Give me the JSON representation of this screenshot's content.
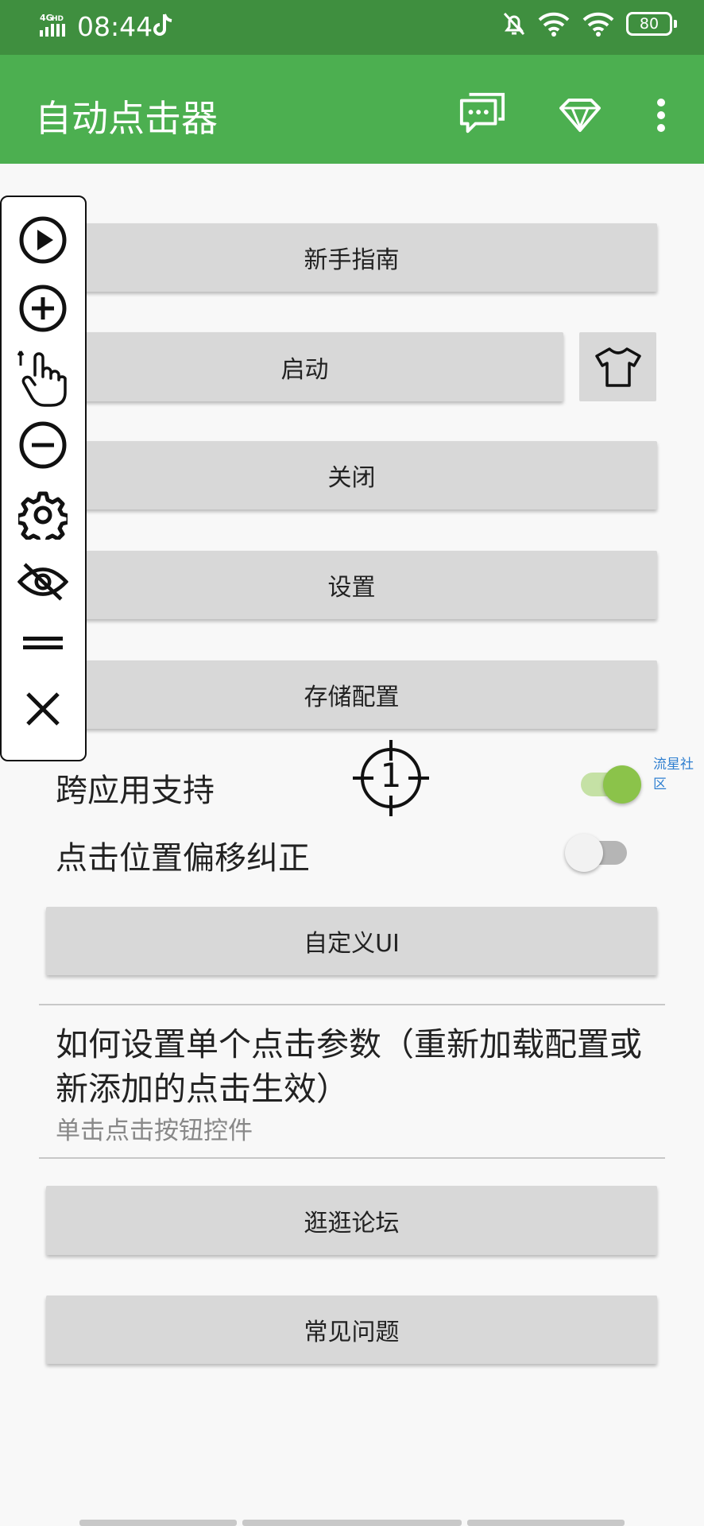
{
  "status_bar": {
    "time": "08:44",
    "network": "4GHD",
    "battery": "80"
  },
  "app_bar": {
    "title": "自动点击器",
    "icons": [
      "chat-icon",
      "diamond-icon",
      "more-vert-icon"
    ]
  },
  "buttons": {
    "guide": "新手指南",
    "start": "启动",
    "close": "关闭",
    "settings": "设置",
    "save_config": "存储配置",
    "custom_ui": "自定义UI",
    "forum": "逛逛论坛",
    "faq": "常见问题"
  },
  "switches": {
    "cross_app": {
      "label": "跨应用支持",
      "on": true
    },
    "offset_fix": {
      "label": "点击位置偏移纠正",
      "on": false
    }
  },
  "info": {
    "title": "如何设置单个点击参数（重新加载配置或新添加的点击生效）",
    "subtitle": "单击点击按钮控件"
  },
  "floating_panel": {
    "icons": [
      "play-icon",
      "add-icon",
      "tap-gesture-icon",
      "remove-icon",
      "gear-icon",
      "eye-off-icon",
      "drag-handle-icon",
      "close-icon"
    ]
  },
  "target": {
    "number": "1"
  },
  "overlay_tag": "流星社区",
  "colors": {
    "appbar": "#4caf50",
    "statusbar": "#3f8f3f",
    "switch_on": "#8bc34a"
  }
}
